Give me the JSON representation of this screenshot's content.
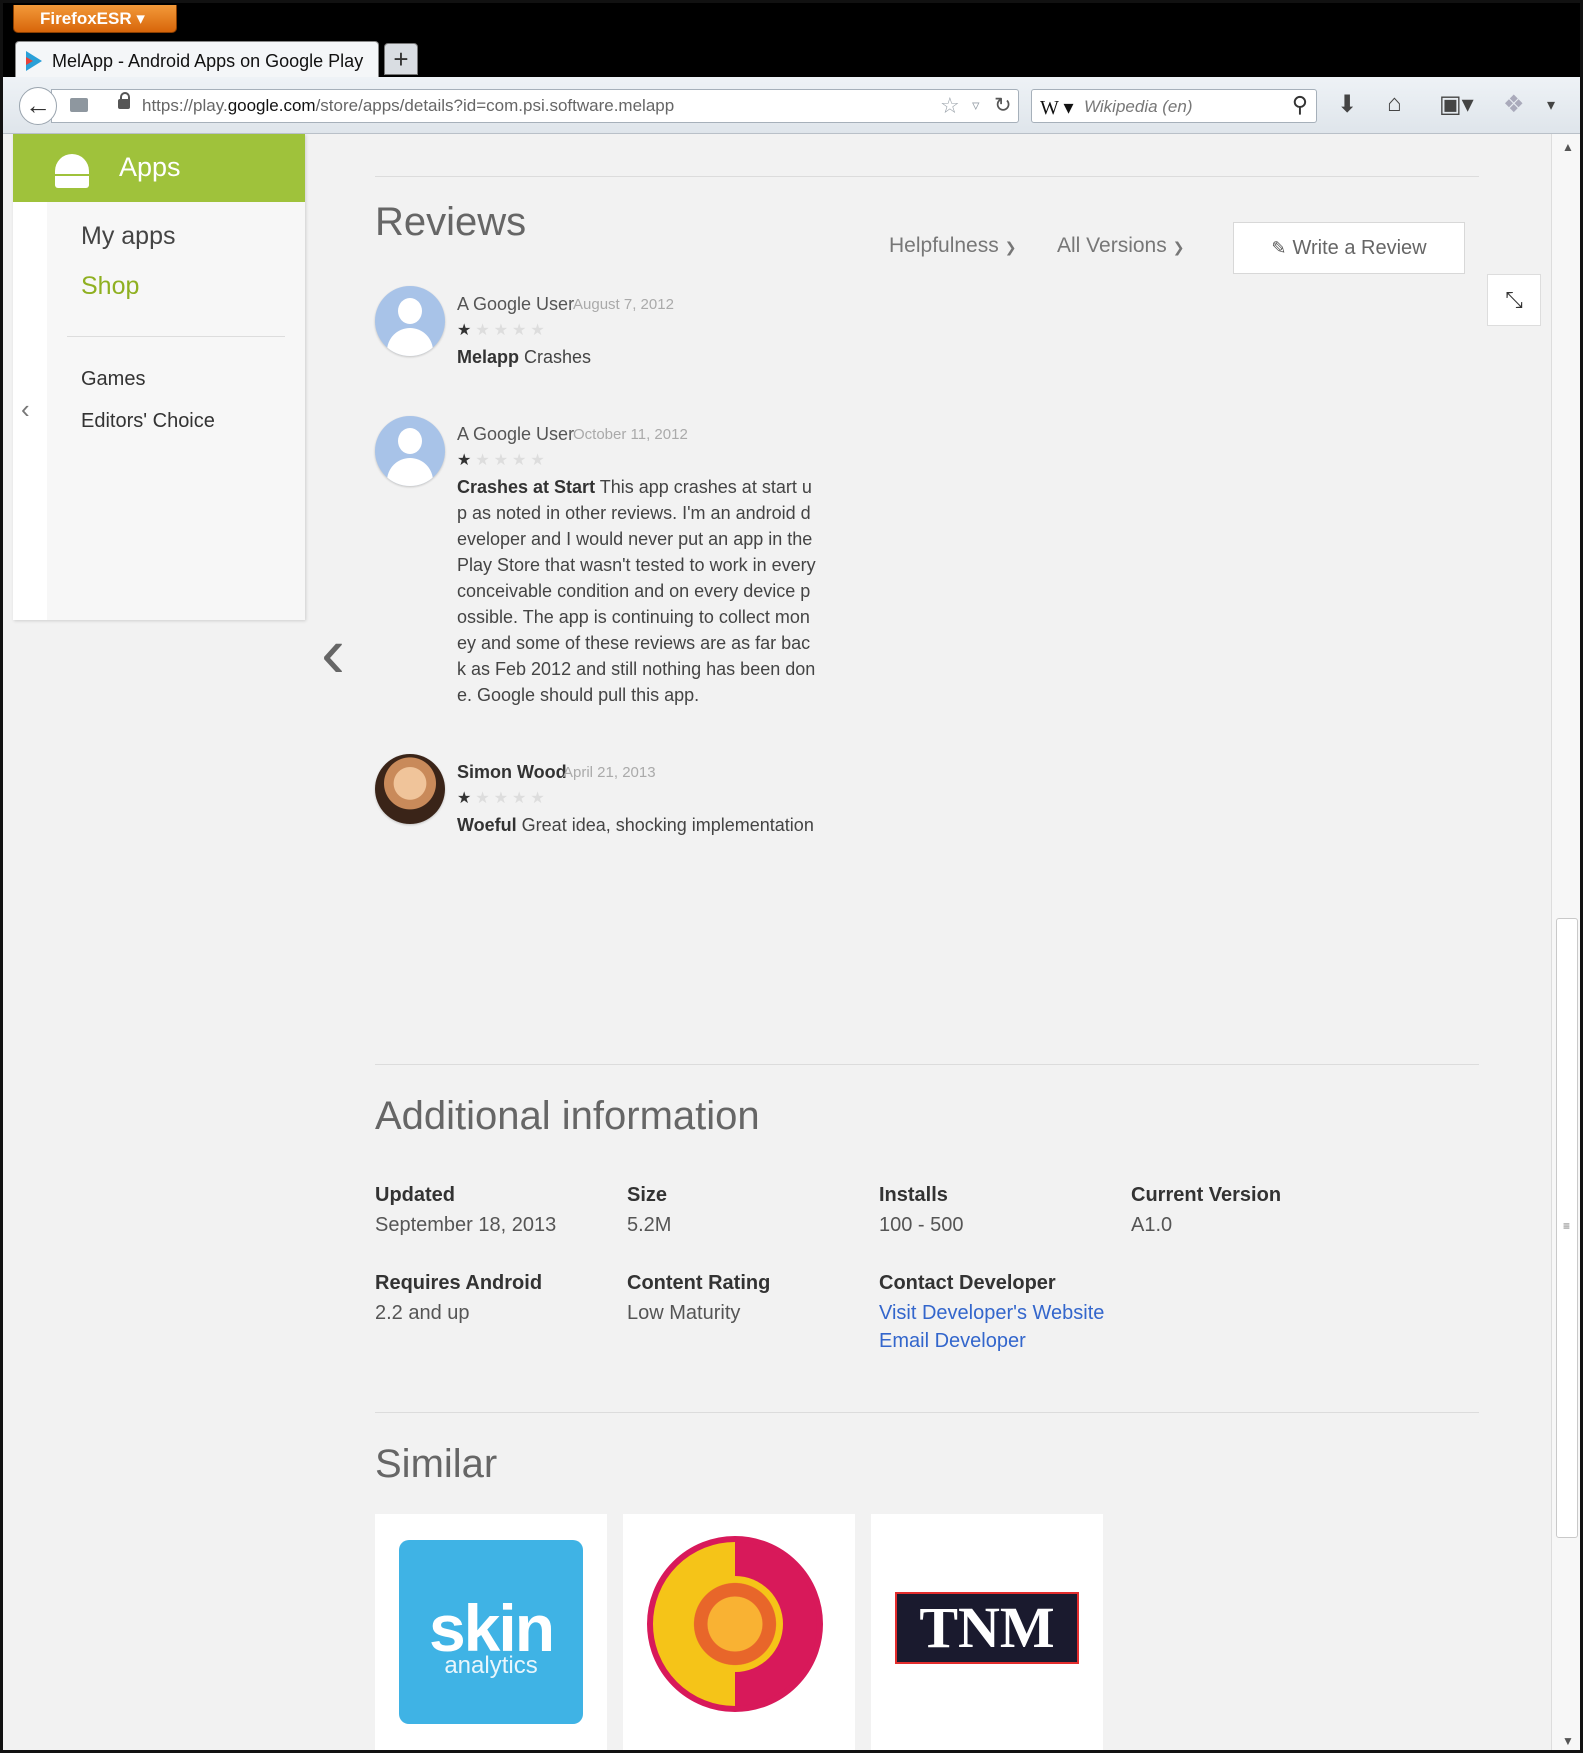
{
  "browser": {
    "menu_button": "FirefoxESR ▾",
    "tab_title": "MelApp - Android Apps on Google Play",
    "new_tab": "+",
    "url_prefix": "https://play.",
    "url_domain": "google.com",
    "url_path": "/store/apps/details?id=com.psi.software.melapp",
    "search_engine": "W ▾",
    "search_placeholder": "Wikipedia (en)"
  },
  "sidebar": {
    "header": "Apps",
    "items": [
      {
        "label": "My apps"
      },
      {
        "label": "Shop"
      },
      {
        "label": "Games"
      },
      {
        "label": "Editors' Choice"
      }
    ],
    "accent_color": "#9fc23b"
  },
  "reviews": {
    "title": "Reviews",
    "sort_label": "Helpfulness",
    "version_label": "All Versions",
    "write_label": "Write a Review",
    "items": [
      {
        "author": "A Google User",
        "date": "August 7, 2012",
        "stars": 1,
        "headline": "Melapp",
        "text": " Crashes"
      },
      {
        "author": "A Google User",
        "date": "October 11, 2012",
        "stars": 1,
        "headline": "Crashes at Start",
        "text": " This app crashes at start up as noted in other reviews. I'm an android developer and I would never put an app in the Play Store that wasn't tested to work in every conceivable condition and on every device possible. The app is continuing to collect money and some of these reviews are as far back as Feb 2012 and still nothing has been done. Google should pull this app."
      },
      {
        "author": "Simon Wood",
        "date": "April 21, 2013",
        "stars": 1,
        "headline": "Woeful",
        "text": " Great idea, shocking implementation"
      }
    ]
  },
  "additional": {
    "title": "Additional information",
    "updated_label": "Updated",
    "updated_value": "September 18, 2013",
    "size_label": "Size",
    "size_value": "5.2M",
    "installs_label": "Installs",
    "installs_value": "100 - 500",
    "version_label": "Current Version",
    "version_value": "A1.0",
    "android_label": "Requires Android",
    "android_value": "2.2 and up",
    "rating_label": "Content Rating",
    "rating_value": "Low Maturity",
    "contact_label": "Contact Developer",
    "website_link": "Visit Developer's Website",
    "email_link": "Email Developer",
    "link_color": "#3366cc"
  },
  "similar": {
    "title": "Similar",
    "apps": [
      {
        "icon": "skin-analytics-icon",
        "logo_text": "skin",
        "logo_sub": "analytics"
      },
      {
        "icon": "sun-face-icon"
      },
      {
        "icon": "tnm-icon",
        "logo_text": "TNM"
      }
    ]
  }
}
